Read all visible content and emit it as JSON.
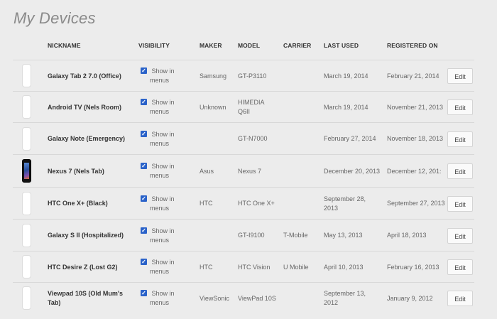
{
  "page_title": "My Devices",
  "columns": {
    "nickname": "NICKNAME",
    "visibility": "VISIBILITY",
    "maker": "MAKER",
    "model": "MODEL",
    "carrier": "CARRIER",
    "last_used": "LAST USED",
    "registered_on": "REGISTERED ON"
  },
  "show_in_menus_line1": "Show in",
  "show_in_menus_line2": "menus",
  "edit_label": "Edit",
  "devices": [
    {
      "nickname": "Galaxy Tab 2 7.0 (Office)",
      "maker": "Samsung",
      "model": "GT-P3110",
      "carrier": "",
      "last_used": "March 19, 2014",
      "registered_on": "February 21, 2014",
      "image": "white-phone",
      "visible_in_menus": true
    },
    {
      "nickname": "Android TV (Nels Room)",
      "maker": "Unknown",
      "model": "HIMEDIA Q6II",
      "carrier": "",
      "last_used": "March 19, 2014",
      "registered_on": "November 21, 2013",
      "image": "white-phone",
      "visible_in_menus": true
    },
    {
      "nickname": "Galaxy Note (Emergency)",
      "maker": "",
      "model": "GT-N7000",
      "carrier": "",
      "last_used": "February 27, 2014",
      "registered_on": "November 18, 2013",
      "image": "white-phone",
      "visible_in_menus": true
    },
    {
      "nickname": "Nexus 7 (Nels Tab)",
      "maker": "Asus",
      "model": "Nexus 7",
      "carrier": "",
      "last_used": "December 20, 2013",
      "registered_on": "December 12, 201:",
      "image": "tablet",
      "visible_in_menus": true
    },
    {
      "nickname": "HTC One X+ (Black)",
      "maker": "HTC",
      "model": "HTC One X+",
      "carrier": "",
      "last_used": "September 28, 2013",
      "registered_on": "September 27, 2013",
      "image": "white-phone",
      "visible_in_menus": true
    },
    {
      "nickname": "Galaxy S II (Hospitalized)",
      "maker": "",
      "model": "GT-I9100",
      "carrier": "T-Mobile",
      "last_used": "May 13, 2013",
      "registered_on": "April 18, 2013",
      "image": "white-phone",
      "visible_in_menus": true
    },
    {
      "nickname": "HTC Desire Z (Lost G2)",
      "maker": "HTC",
      "model": "HTC Vision",
      "carrier": "U Mobile",
      "last_used": "April 10, 2013",
      "registered_on": "February 16, 2013",
      "image": "white-phone",
      "visible_in_menus": true
    },
    {
      "nickname": "Viewpad 10S (Old Mum's Tab)",
      "maker": "ViewSonic",
      "model": "ViewPad 10S",
      "carrier": "",
      "last_used": "September 13, 2012",
      "registered_on": "January 9, 2012",
      "image": "white-phone",
      "visible_in_menus": true
    }
  ],
  "colors": {
    "checkbox": "#2a62c9",
    "background": "#ececec"
  }
}
